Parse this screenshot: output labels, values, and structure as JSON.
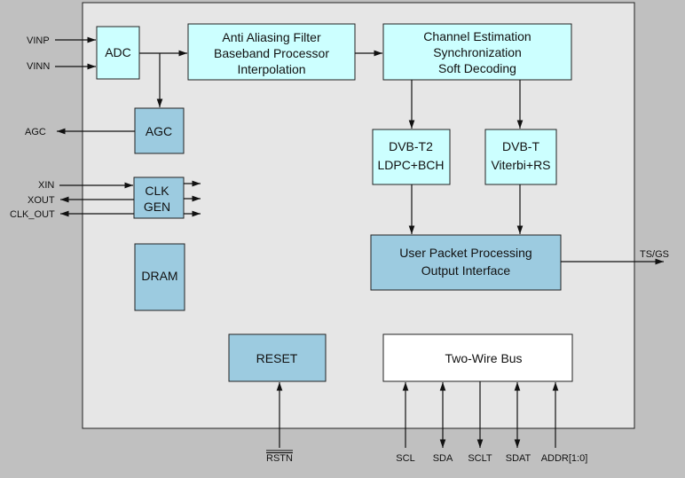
{
  "colors": {
    "outside": "#c0c0c0",
    "chip": "#e6e6e6",
    "light_block": "#ccffff",
    "dark_block": "#9ccbe0",
    "white_block": "#ffffff"
  },
  "blocks": {
    "adc": "ADC",
    "filter": [
      "Anti Aliasing Filter",
      "Baseband Processor",
      "Interpolation"
    ],
    "channel": [
      "Channel Estimation",
      "Synchronization",
      "Soft Decoding"
    ],
    "agc": "AGC",
    "clkgen": [
      "CLK",
      "GEN"
    ],
    "dram": "DRAM",
    "dvbt2": [
      "DVB-T2",
      "LDPC+BCH"
    ],
    "dvbt": [
      "DVB-T",
      "Viterbi+RS"
    ],
    "upp": [
      "User Packet Processing",
      "Output Interface"
    ],
    "reset": "RESET",
    "twowire": "Two-Wire Bus"
  },
  "pins": {
    "vinp": "VINP",
    "vinn": "VINN",
    "agc": "AGC",
    "xin": "XIN",
    "xout": "XOUT",
    "clk_out": "CLK_OUT",
    "ts": "TS/GS",
    "rstn": "RSTN",
    "scl": "SCL",
    "sda": "SDA",
    "sclt": "SCLT",
    "sdat": "SDAT",
    "addr": "ADDR[1:0]"
  }
}
